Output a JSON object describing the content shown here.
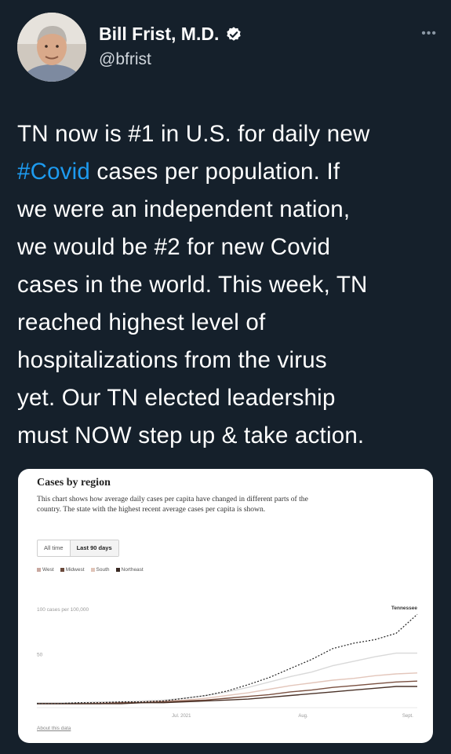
{
  "tweet": {
    "author_name": "Bill Frist, M.D.",
    "handle": "@bfrist",
    "text_lines": [
      [
        "TN now is #1 in U.S. for daily new"
      ],
      [
        "#Covid",
        " cases per population. If"
      ],
      [
        "we were an independent nation,"
      ],
      [
        "we would be #2 for new Covid"
      ],
      [
        "cases in the world. This week, TN"
      ],
      [
        "reached highest level of"
      ],
      [
        "hospitalizations from the virus"
      ],
      [
        "yet. Our TN elected leadership"
      ],
      [
        "must NOW step up & take action."
      ]
    ],
    "hashtag": "#Covid",
    "hashtag_color": "#1d9bf0",
    "verified": true,
    "more_icon": "more-horizontal-icon"
  },
  "chart_card": {
    "title": "Cases by region",
    "description": "This chart shows how average daily cases per capita have changed in different parts of the country. The state with the highest recent average cases per capita is shown.",
    "toggle": {
      "all_time": "All time",
      "last_90_days": "Last 90 days",
      "selected": "last_90_days"
    },
    "legend": [
      {
        "name": "West",
        "color": "#c9a8a0"
      },
      {
        "name": "Midwest",
        "color": "#6b4a3c"
      },
      {
        "name": "South",
        "color": "#e0c4b8"
      },
      {
        "name": "Northeast",
        "color": "#3a2a24"
      }
    ],
    "about_link": "About this data"
  },
  "chart_data": {
    "type": "line",
    "title": "Cases by region",
    "ylabel": "100 cases per 100,000",
    "y_ticks": [
      50
    ],
    "ylim": [
      0,
      115
    ],
    "x_tick_labels": [
      "Jul. 2021",
      "Aug.",
      "Sept."
    ],
    "x": [
      0,
      5,
      10,
      15,
      20,
      25,
      30,
      35,
      40,
      45,
      50,
      55,
      60,
      65,
      70,
      75,
      80,
      85,
      90
    ],
    "series": [
      {
        "name": "West",
        "color": "#d9d9d9",
        "values": [
          2,
          2,
          2,
          3,
          3,
          4,
          5,
          7,
          10,
          14,
          19,
          25,
          31,
          36,
          43,
          48,
          53,
          57,
          57
        ]
      },
      {
        "name": "South",
        "color": "#e3c6bb",
        "values": [
          1,
          1,
          1,
          2,
          2,
          3,
          4,
          5,
          7,
          10,
          13,
          17,
          21,
          24,
          27,
          29,
          32,
          34,
          35
        ]
      },
      {
        "name": "Midwest",
        "color": "#7a5040",
        "values": [
          1,
          1,
          1,
          1,
          2,
          2,
          3,
          4,
          5,
          7,
          9,
          11,
          14,
          16,
          19,
          21,
          23,
          25,
          26
        ]
      },
      {
        "name": "Northeast",
        "color": "#4a3228",
        "values": [
          1,
          1,
          1,
          1,
          1,
          2,
          2,
          3,
          4,
          5,
          6,
          8,
          10,
          12,
          14,
          16,
          18,
          20,
          20
        ]
      }
    ],
    "highlight": {
      "name": "Tennessee",
      "values": [
        1,
        1,
        2,
        2,
        3,
        3,
        4,
        7,
        10,
        15,
        22,
        30,
        40,
        50,
        62,
        68,
        72,
        79,
        100
      ],
      "color": "#222222"
    },
    "legend_position": "top-left",
    "grid": false
  }
}
